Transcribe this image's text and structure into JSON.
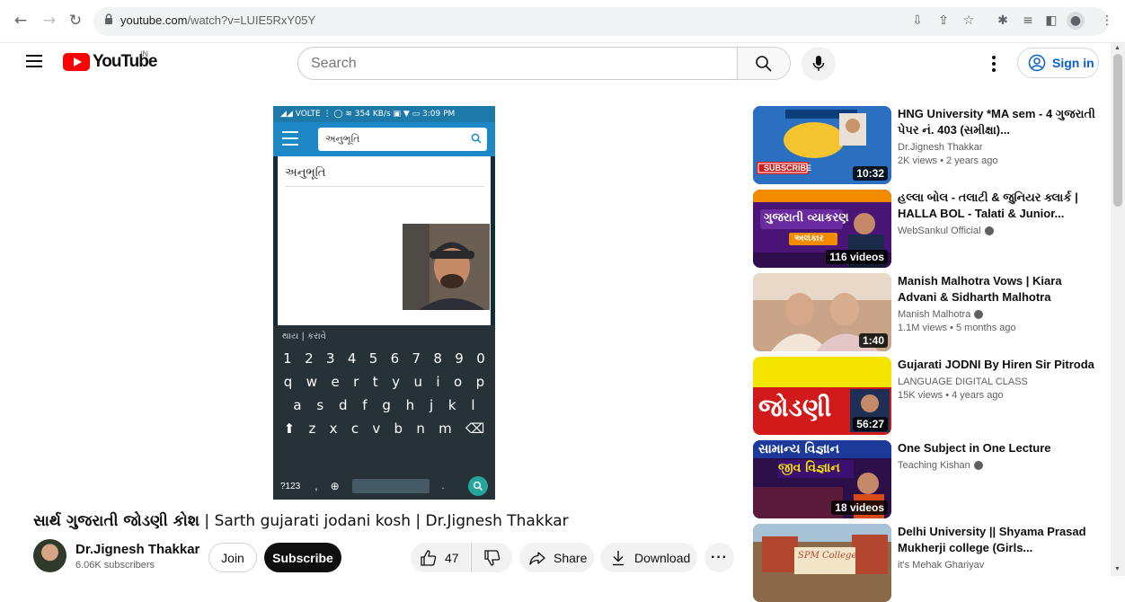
{
  "browser": {
    "url_host": "youtube.com",
    "url_path": "/watch?v=LUIE5RxY05Y"
  },
  "header": {
    "logo_text": "YouTube",
    "country": "IN",
    "search_placeholder": "Search",
    "signin_label": "Sign in"
  },
  "player": {
    "status_bar": "◢◢ VOLTE ⋮ ◯ ≋  354 KB/s  ▣ ▼ ▭ 3:09 PM",
    "search_text": "અનુભૂતિ",
    "suggestion": "અનુભૂતિ",
    "kb_top": "થાય  |  કરાવે",
    "kb_row1": [
      "1",
      "2",
      "3",
      "4",
      "5",
      "6",
      "7",
      "8",
      "9",
      "0"
    ],
    "kb_row2": [
      "q",
      "w",
      "e",
      "r",
      "t",
      "y",
      "u",
      "i",
      "o",
      "p"
    ],
    "kb_row3": [
      "a",
      "s",
      "d",
      "f",
      "g",
      "h",
      "j",
      "k",
      "l"
    ],
    "kb_row4": [
      "⬆",
      "z",
      "x",
      "c",
      "v",
      "b",
      "n",
      "m",
      "⌫"
    ],
    "kb_sym": "?123"
  },
  "video": {
    "title_gu": "સાર્થ ગુજરાતી જોડણી કોશ",
    "title_rest": " | Sarth gujarati jodani kosh | Dr.Jignesh Thakkar",
    "channel": "Dr.Jignesh Thakkar",
    "subscribers": "6.06K subscribers",
    "join": "Join",
    "subscribe": "Subscribe",
    "likes": "47",
    "share": "Share",
    "download": "Download",
    "more": "···"
  },
  "related": [
    {
      "title": "HNG University *MA sem - 4 ગુજરાતી પેપર નં. 403 (સમીક્ષા)...",
      "channel": "Dr.Jignesh Thakkar",
      "verified": false,
      "meta": "2K views • 2 years ago",
      "badge": "10:32"
    },
    {
      "title": "હલ્લા બોલ - તલાટી & જુનિયર ક્લાર્ક | HALLA BOL - Talati & Junior...",
      "channel": "WebSankul Official",
      "verified": true,
      "meta": "",
      "badge": "116 videos"
    },
    {
      "title": "Manish Malhotra Vows | Kiara Advani & Sidharth Malhotra",
      "channel": "Manish Malhotra",
      "verified": true,
      "meta": "1.1M views • 5 months ago",
      "badge": "1:40"
    },
    {
      "title": "Gujarati JODNI By Hiren Sir Pitroda",
      "channel": "LANGUAGE DIGITAL CLASS",
      "verified": false,
      "meta": "15K views • 4 years ago",
      "badge": "56:27"
    },
    {
      "title": "One Subject in One Lecture",
      "channel": "Teaching Kishan",
      "verified": true,
      "meta": "",
      "badge": "18 videos"
    },
    {
      "title": "Delhi University || Shyama Prasad Mukherji college (Girls...",
      "channel": "it's Mehak Ghariyav",
      "verified": false,
      "meta": "",
      "badge": ""
    }
  ],
  "thumb_text": {
    "t1_subscribe": "SUBSCRIBE",
    "t2_banner": "ગુજરાતી વ્યાકરણ",
    "t2_sub": "અલંકાર",
    "t4_word": "જોડણી",
    "t5_title": "સામાન્ય વિજ્ઞાન",
    "t5_sub": "જીવ વિજ્ઞાન",
    "t6_label": "SPM College"
  }
}
